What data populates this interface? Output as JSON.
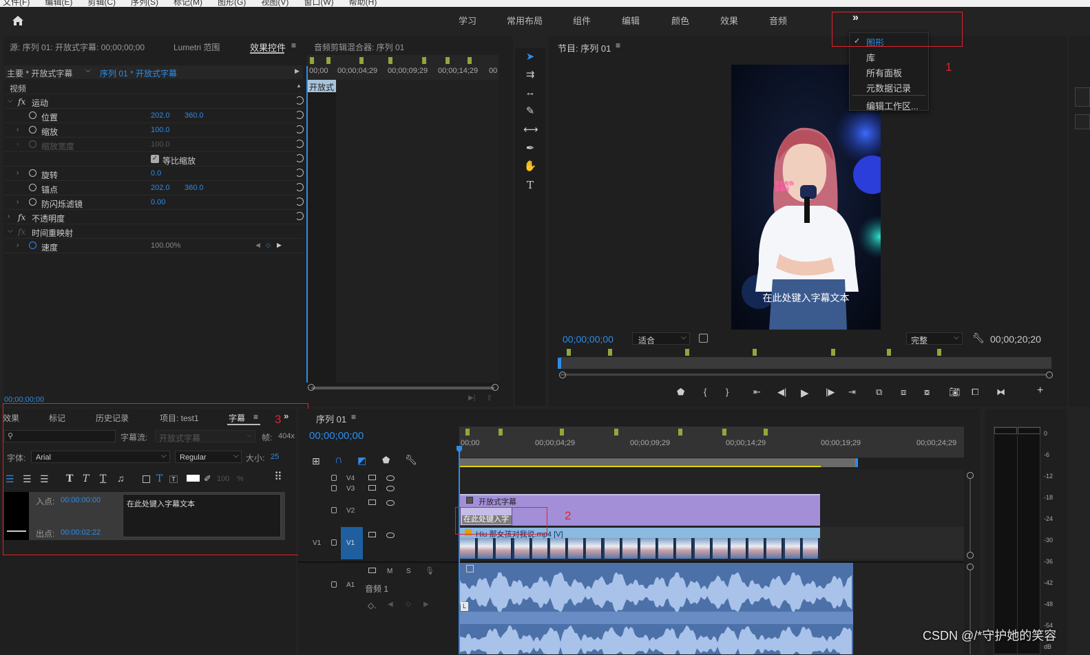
{
  "menubar": {
    "items": [
      "文件(F)",
      "编辑(E)",
      "剪辑(C)",
      "序列(S)",
      "标记(M)",
      "图形(G)",
      "视图(V)",
      "窗口(W)",
      "帮助(H)"
    ]
  },
  "workspaces": {
    "tabs": [
      "学习",
      "常用布局",
      "组件",
      "编辑",
      "颜色",
      "效果",
      "音频"
    ],
    "overflow": "»"
  },
  "ws_menu": {
    "items": [
      "图形",
      "库",
      "所有面板",
      "元数据记录",
      "编辑工作区..."
    ],
    "checked": "图形"
  },
  "annotations": {
    "n1": "1",
    "n2": "2",
    "n3": "3"
  },
  "source_panel": {
    "tabs": [
      "源: 序列 01: 开放式字幕: 00;00;00;00",
      "Lumetri 范围",
      "效果控件",
      "音频剪辑混合器: 序列 01"
    ],
    "active": "效果控件",
    "master": "主要 * 开放式字幕",
    "seq": "序列 01 * 开放式字幕",
    "ruler": [
      "00;00",
      "00;00;04;29",
      "00;00;09;29",
      "00;00;14;29",
      "00"
    ],
    "clip": "开放式",
    "section_video": "视频",
    "motion": "运动",
    "position": "位置",
    "pos_x": "202.0",
    "pos_y": "360.0",
    "scale": "缩放",
    "scale_v": "100.0",
    "scale_w": "缩放宽度",
    "scale_w_v": "100.0",
    "uniform": "等比缩放",
    "rotation": "旋转",
    "rot_v": "0.0",
    "anchor": "锚点",
    "anc_x": "202.0",
    "anc_y": "360.0",
    "flicker": "防闪烁滤镜",
    "flick_v": "0.00",
    "opacity": "不透明度",
    "remap": "时间重映射",
    "speed": "速度",
    "speed_v": "100.00%",
    "timecode": "00;00;00;00"
  },
  "program": {
    "title": "节目: 序列 01",
    "timecode": "00;00;00;00",
    "fit": "适合",
    "quality": "完整",
    "duration": "00;00;20;20",
    "caption": "在此处键入字幕文本",
    "mic_logo": "青春有你 直播间"
  },
  "captions_panel": {
    "tabs": [
      "效果",
      "标记",
      "历史记录",
      "项目: test1",
      "字幕"
    ],
    "active": "字幕",
    "stream_label": "字幕流:",
    "stream_value": "开放式字幕",
    "frame_label": "帧:",
    "frame_value": "404x",
    "font_label": "字体:",
    "font": "Arial",
    "style": "Regular",
    "size_label": "大小:",
    "size": "25",
    "opacity": "100",
    "opacity_unit": "%",
    "in_label": "入点:",
    "in_tc": "00:00:00:00",
    "out_label": "出点:",
    "out_tc": "00:00:02:22",
    "text": "在此处键入字幕文本"
  },
  "timeline": {
    "title": "序列 01",
    "timecode": "00;00;00;00",
    "ruler": [
      "00;00",
      "00;00;04;29",
      "00;00;09;29",
      "00;00;14;29",
      "00;00;19;29",
      "00;00;24;29"
    ],
    "tracks": {
      "v4": "V4",
      "v3": "V3",
      "v2": "V2",
      "v1": "V1",
      "a1": "A1",
      "a1_name": "音频 1"
    },
    "caption_clip": "开放式字幕",
    "caption_item": "在此处键入字",
    "video_clip": "Hiu 那女孩对我说.mp4 [V]",
    "audio_m": "M",
    "audio_s": "S"
  },
  "meter": {
    "labels": [
      "0",
      "-6",
      "-12",
      "-18",
      "-24",
      "-30",
      "-36",
      "-42",
      "-48",
      "-54"
    ],
    "unit": "dB"
  },
  "watermark": "CSDN @/*守护她的笑容"
}
